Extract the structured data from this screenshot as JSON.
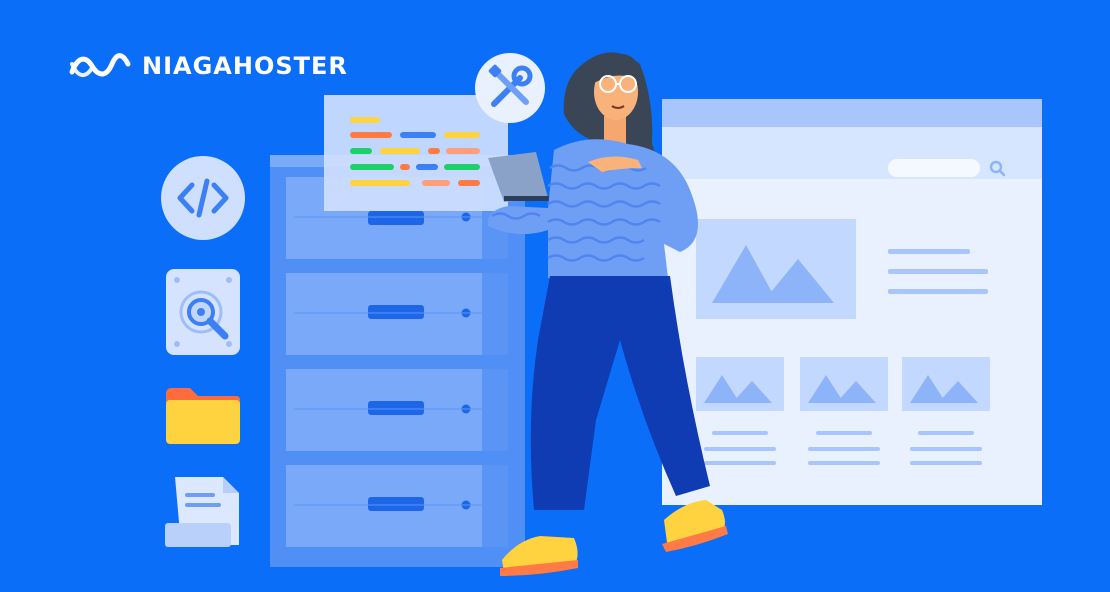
{
  "brand": {
    "name": "NIAGAHOSTER"
  },
  "colors": {
    "background": "#0b6ef8",
    "cabinet": "#4f8ff6",
    "panel_light": "#e9f1ff",
    "accent_yellow": "#ffd23f",
    "accent_orange": "#ff7a45",
    "accent_green": "#1fcf6a",
    "pants": "#0f3bb3"
  },
  "icons": [
    "code-icon",
    "hard-drive-search-icon",
    "folder-icon",
    "document-icon",
    "wrench-screwdriver-icon",
    "search-icon"
  ]
}
